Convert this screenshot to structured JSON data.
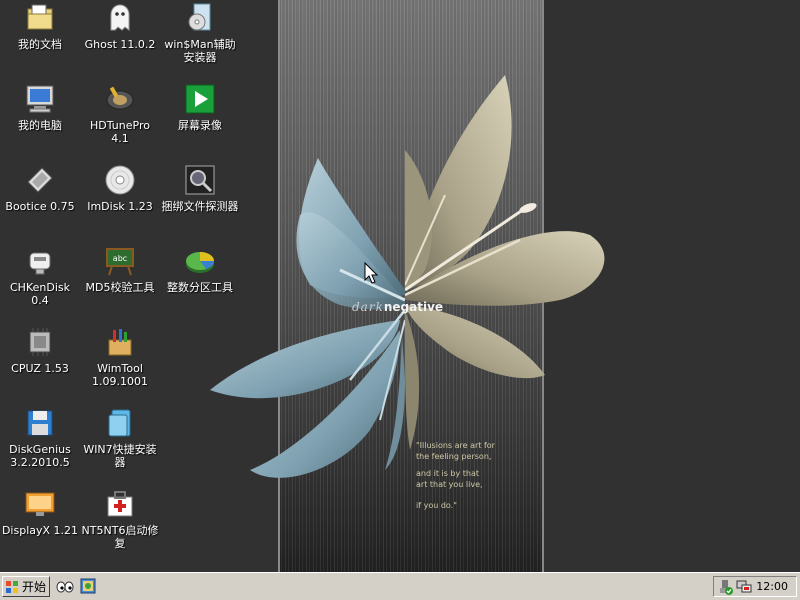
{
  "desktop": {
    "icons": [
      {
        "label": "我的文档",
        "icon": "my-documents-icon"
      },
      {
        "label": "我的电脑",
        "icon": "my-computer-icon"
      },
      {
        "label": "Bootice 0.75",
        "icon": "bootice-icon"
      },
      {
        "label": "CHKenDisk 0.4",
        "icon": "chkendisk-icon"
      },
      {
        "label": "CPUZ 1.53",
        "icon": "cpuz-icon"
      },
      {
        "label": "DiskGenius 3.2.2010.5",
        "icon": "diskgenius-icon"
      },
      {
        "label": "DisplayX 1.21",
        "icon": "displayx-icon"
      },
      {
        "label": "Ghost 11.0.2",
        "icon": "ghost-icon"
      },
      {
        "label": "HDTunePro 4.1",
        "icon": "hdtune-icon"
      },
      {
        "label": "ImDisk 1.23",
        "icon": "imdisk-icon"
      },
      {
        "label": "MD5校验工具",
        "icon": "md5-tool-icon"
      },
      {
        "label": "WimTool 1.09.1001",
        "icon": "wimtool-icon"
      },
      {
        "label": "WIN7快捷安装器",
        "icon": "win7-installer-icon"
      },
      {
        "label": "NT5NT6启动修复",
        "icon": "boot-repair-icon"
      },
      {
        "label": "win$Man辅助安装器",
        "icon": "winntsetup-icon"
      },
      {
        "label": "屏幕录像",
        "icon": "screen-recorder-icon"
      },
      {
        "label": "捆绑文件探测器",
        "icon": "file-detector-icon"
      },
      {
        "label": "整数分区工具",
        "icon": "partition-tool-icon"
      }
    ]
  },
  "wallpaper": {
    "brand_dark": "dark",
    "brand_negative": "negative",
    "quote": [
      "\"Illusions are art for",
      "the feeling person,",
      "and it is by that",
      "art that you live,",
      "if you do.\""
    ]
  },
  "taskbar": {
    "start_label": "开始",
    "clock": "12:00"
  },
  "colors": {
    "desktop_bg": "#313131",
    "taskbar": "#d4d0c8",
    "petal_blue": "#8fb2c2",
    "petal_beige": "#bdb69a"
  }
}
